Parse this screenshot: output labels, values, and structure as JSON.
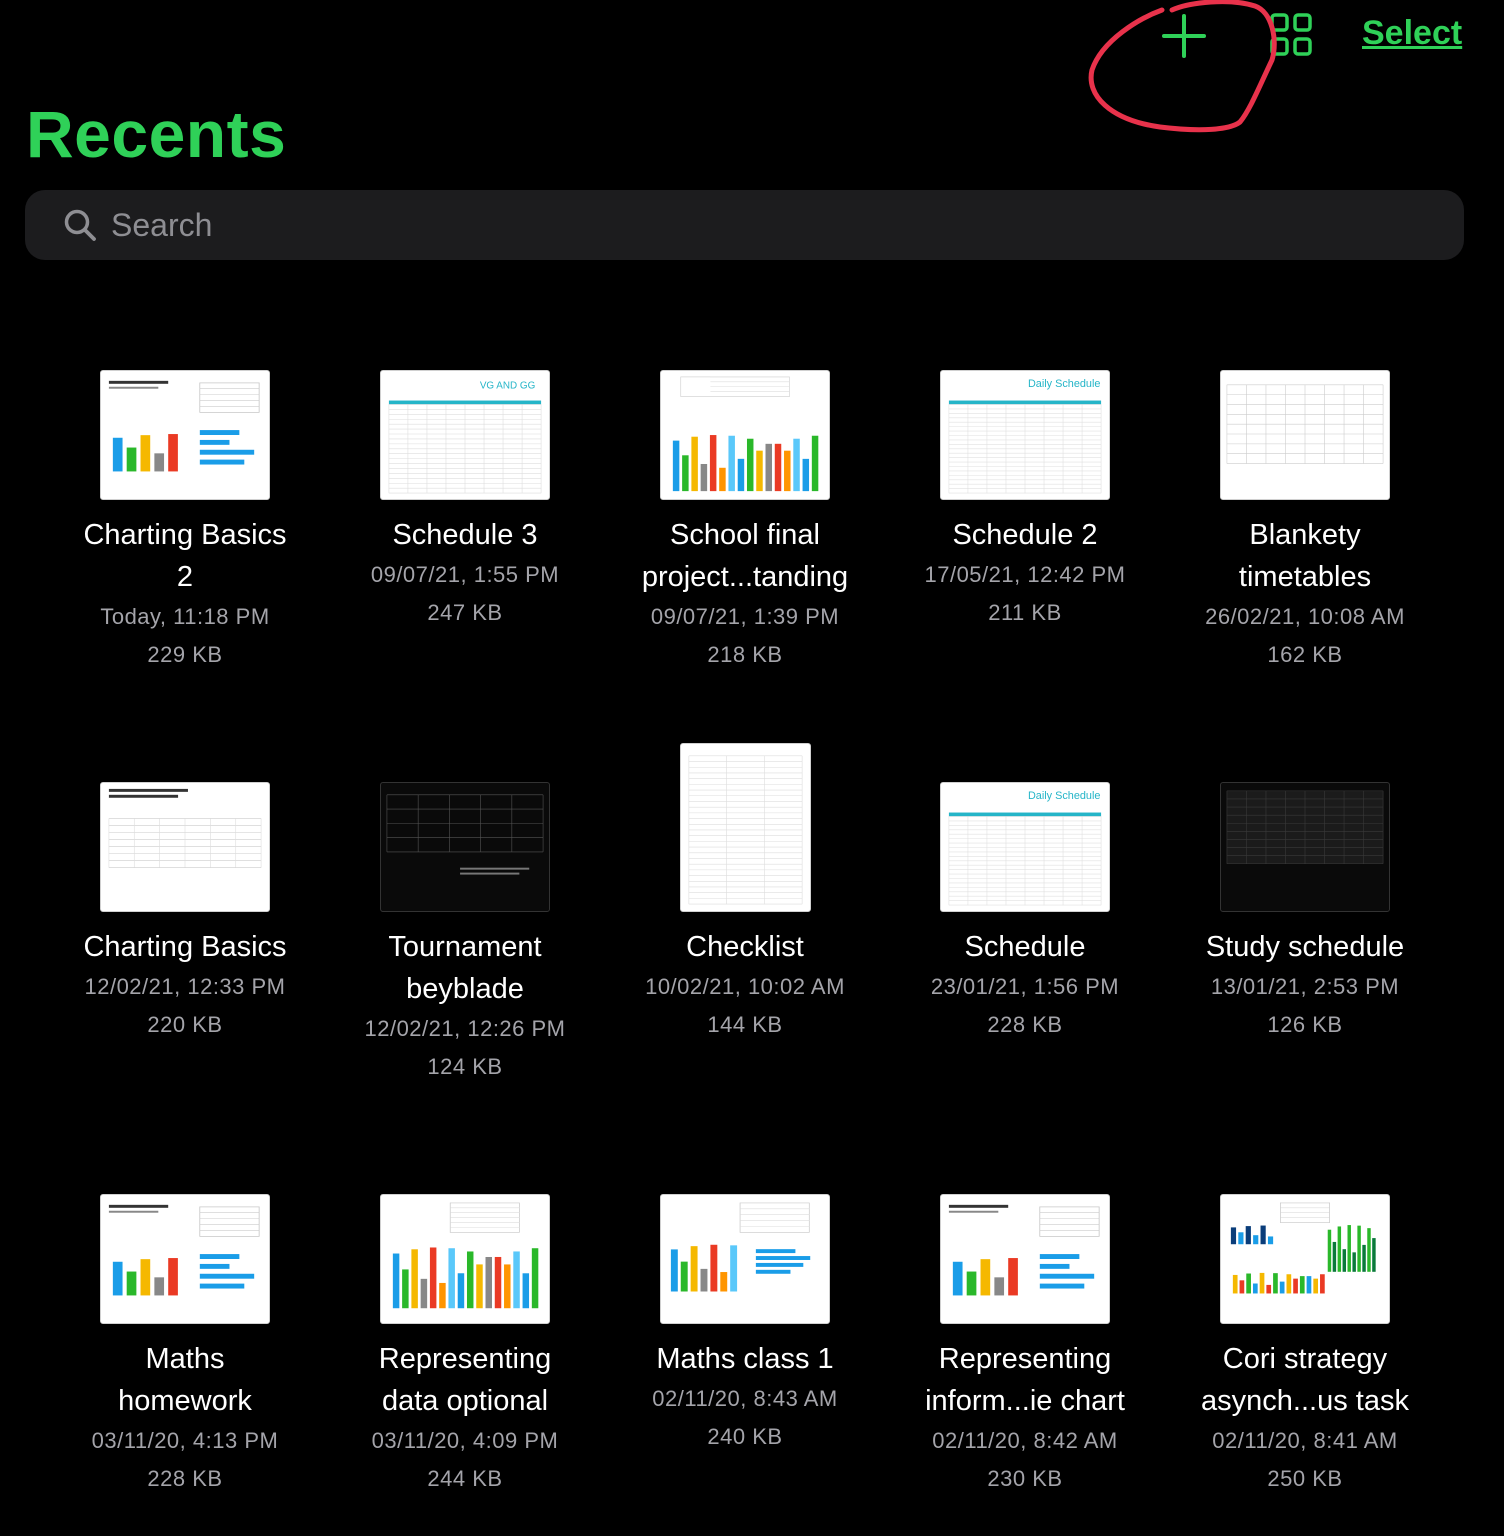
{
  "toolbar": {
    "add_icon": "plus-icon",
    "view_icon": "grid-view-icon",
    "select_label": "Select",
    "accent_color": "#2fd158"
  },
  "title": "Recents",
  "search": {
    "placeholder": "Search",
    "icon": "magnifying-glass-icon"
  },
  "files": [
    {
      "name_lines": [
        "Charting Basics",
        "2"
      ],
      "date": "Today, 11:18 PM",
      "size": "229 KB",
      "thumb": "chart-bars-h"
    },
    {
      "name_lines": [
        "Schedule 3"
      ],
      "date": "09/07/21, 1:55 PM",
      "size": "247 KB",
      "thumb": "schedule-teal"
    },
    {
      "name_lines": [
        "School final",
        "project...tanding"
      ],
      "date": "09/07/21, 1:39 PM",
      "size": "218 KB",
      "thumb": "chart-bars"
    },
    {
      "name_lines": [
        "Schedule 2"
      ],
      "date": "17/05/21, 12:42 PM",
      "size": "211 KB",
      "thumb": "daily-schedule"
    },
    {
      "name_lines": [
        "Blankety",
        "timetables"
      ],
      "date": "26/02/21, 10:08 AM",
      "size": "162 KB",
      "thumb": "table"
    },
    {
      "name_lines": [
        "Charting Basics"
      ],
      "date": "12/02/21, 12:33 PM",
      "size": "220 KB",
      "thumb": "text-table"
    },
    {
      "name_lines": [
        "Tournament",
        "beyblade"
      ],
      "date": "12/02/21, 12:26 PM",
      "size": "124 KB",
      "thumb": "dark-table"
    },
    {
      "name_lines": [
        "Checklist"
      ],
      "date": "10/02/21, 10:02 AM",
      "size": "144 KB",
      "thumb": "checklist"
    },
    {
      "name_lines": [
        "Schedule"
      ],
      "date": "23/01/21, 1:56 PM",
      "size": "228 KB",
      "thumb": "daily-schedule"
    },
    {
      "name_lines": [
        "Study schedule"
      ],
      "date": "13/01/21, 2:53 PM",
      "size": "126 KB",
      "thumb": "dark-grid"
    },
    {
      "name_lines": [
        "Maths",
        "homework"
      ],
      "date": "03/11/20, 4:13 PM",
      "size": "228 KB",
      "thumb": "chart-bars-h"
    },
    {
      "name_lines": [
        "Representing",
        "data optional"
      ],
      "date": "03/11/20, 4:09 PM",
      "size": "244 KB",
      "thumb": "chart-many-bars"
    },
    {
      "name_lines": [
        "Maths class 1"
      ],
      "date": "02/11/20, 8:43 AM",
      "size": "240 KB",
      "thumb": "chart-3d"
    },
    {
      "name_lines": [
        "Representing",
        "inform...ie chart"
      ],
      "date": "02/11/20, 8:42 AM",
      "size": "230 KB",
      "thumb": "chart-bars-h"
    },
    {
      "name_lines": [
        "Cori strategy",
        "asynch...us task"
      ],
      "date": "02/11/20, 8:41 AM",
      "size": "250 KB",
      "thumb": "chart-multi"
    }
  ]
}
